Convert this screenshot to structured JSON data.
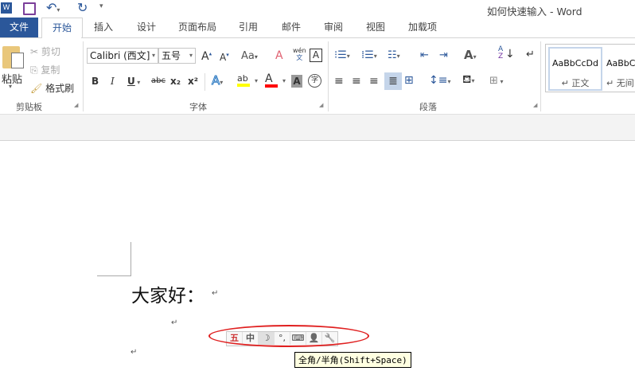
{
  "title": "如何快速输入 - Word",
  "qat": {
    "icons": [
      "word-logo-icon",
      "save-icon",
      "undo-icon",
      "redo-icon",
      "customize-icon"
    ]
  },
  "tabs": [
    "文件",
    "开始",
    "插入",
    "设计",
    "页面布局",
    "引用",
    "邮件",
    "审阅",
    "视图",
    "加载项"
  ],
  "clipboard": {
    "paste": "粘贴",
    "cut": "剪切",
    "copy": "复制",
    "format_painter": "格式刷",
    "label": "剪贴板"
  },
  "font": {
    "name": "Calibri (西文]",
    "size": "五号",
    "case": "Aa",
    "bold": "B",
    "italic": "I",
    "underline": "U",
    "strike": "abc",
    "sub": "x₂",
    "sup": "x²",
    "pinyin": "wén",
    "label": "字体"
  },
  "paragraph": {
    "label": "段落"
  },
  "styles": {
    "items": [
      "AaBbCcDd",
      "AaBbC"
    ],
    "names": [
      "↵ 正文",
      "↵ 无间"
    ]
  },
  "doc": {
    "text": "大家好：",
    "return": "↵"
  },
  "ime": {
    "items": [
      "五",
      "中",
      "☽",
      "°,",
      "⌨",
      "👤",
      "🔧"
    ]
  },
  "tooltip": "全角/半角(Shift+Space)",
  "colors": {
    "accent": "#2b579a",
    "highlight": "#ffff00",
    "font_color": "#ff0000",
    "ellipse": "#e02020"
  }
}
